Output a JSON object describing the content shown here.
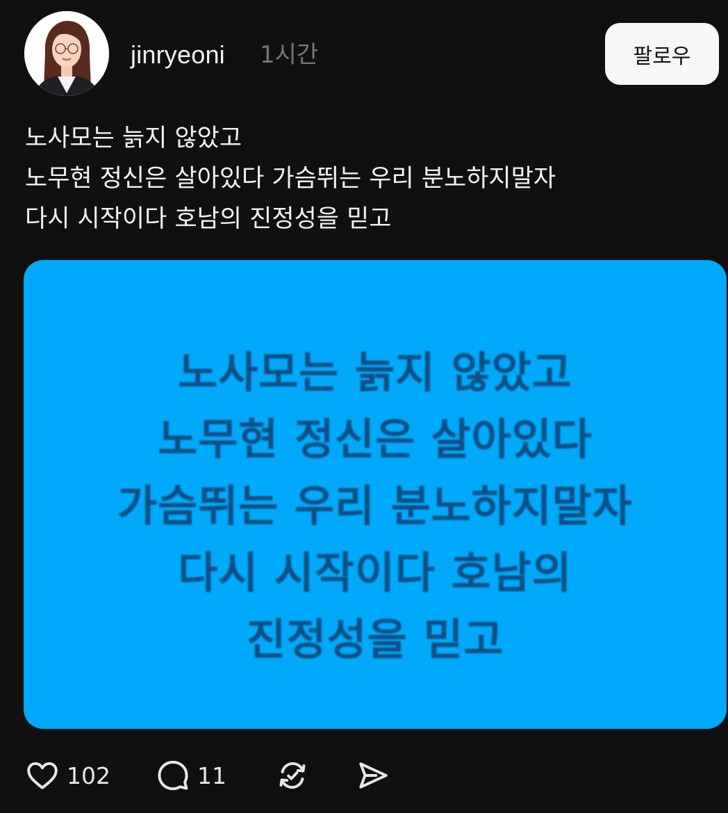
{
  "post": {
    "username": "jinryeoni",
    "timestamp": "1시간",
    "follow_label": "팔로우",
    "caption_lines": [
      "노사모는 늙지 않았고",
      "노무현 정신은 살아있다 가슴뛰는 우리 분노하지말자",
      "다시 시작이다 호남의 진정성을 믿고"
    ],
    "image": {
      "background_color": "#00a9f9",
      "text_color": "#0e4f86",
      "lines": [
        "노사모는 늙지 않았고",
        "노무현 정신은 살아있다",
        "가슴뛰는 우리 분노하지말자",
        "다시 시작이다 호남의",
        "진정성을 믿고"
      ]
    },
    "actions": {
      "like_icon": "heart-icon",
      "like_count": "102",
      "reply_icon": "comment-icon",
      "reply_count": "11",
      "repost_icon": "repost-icon",
      "share_icon": "send-icon"
    }
  }
}
